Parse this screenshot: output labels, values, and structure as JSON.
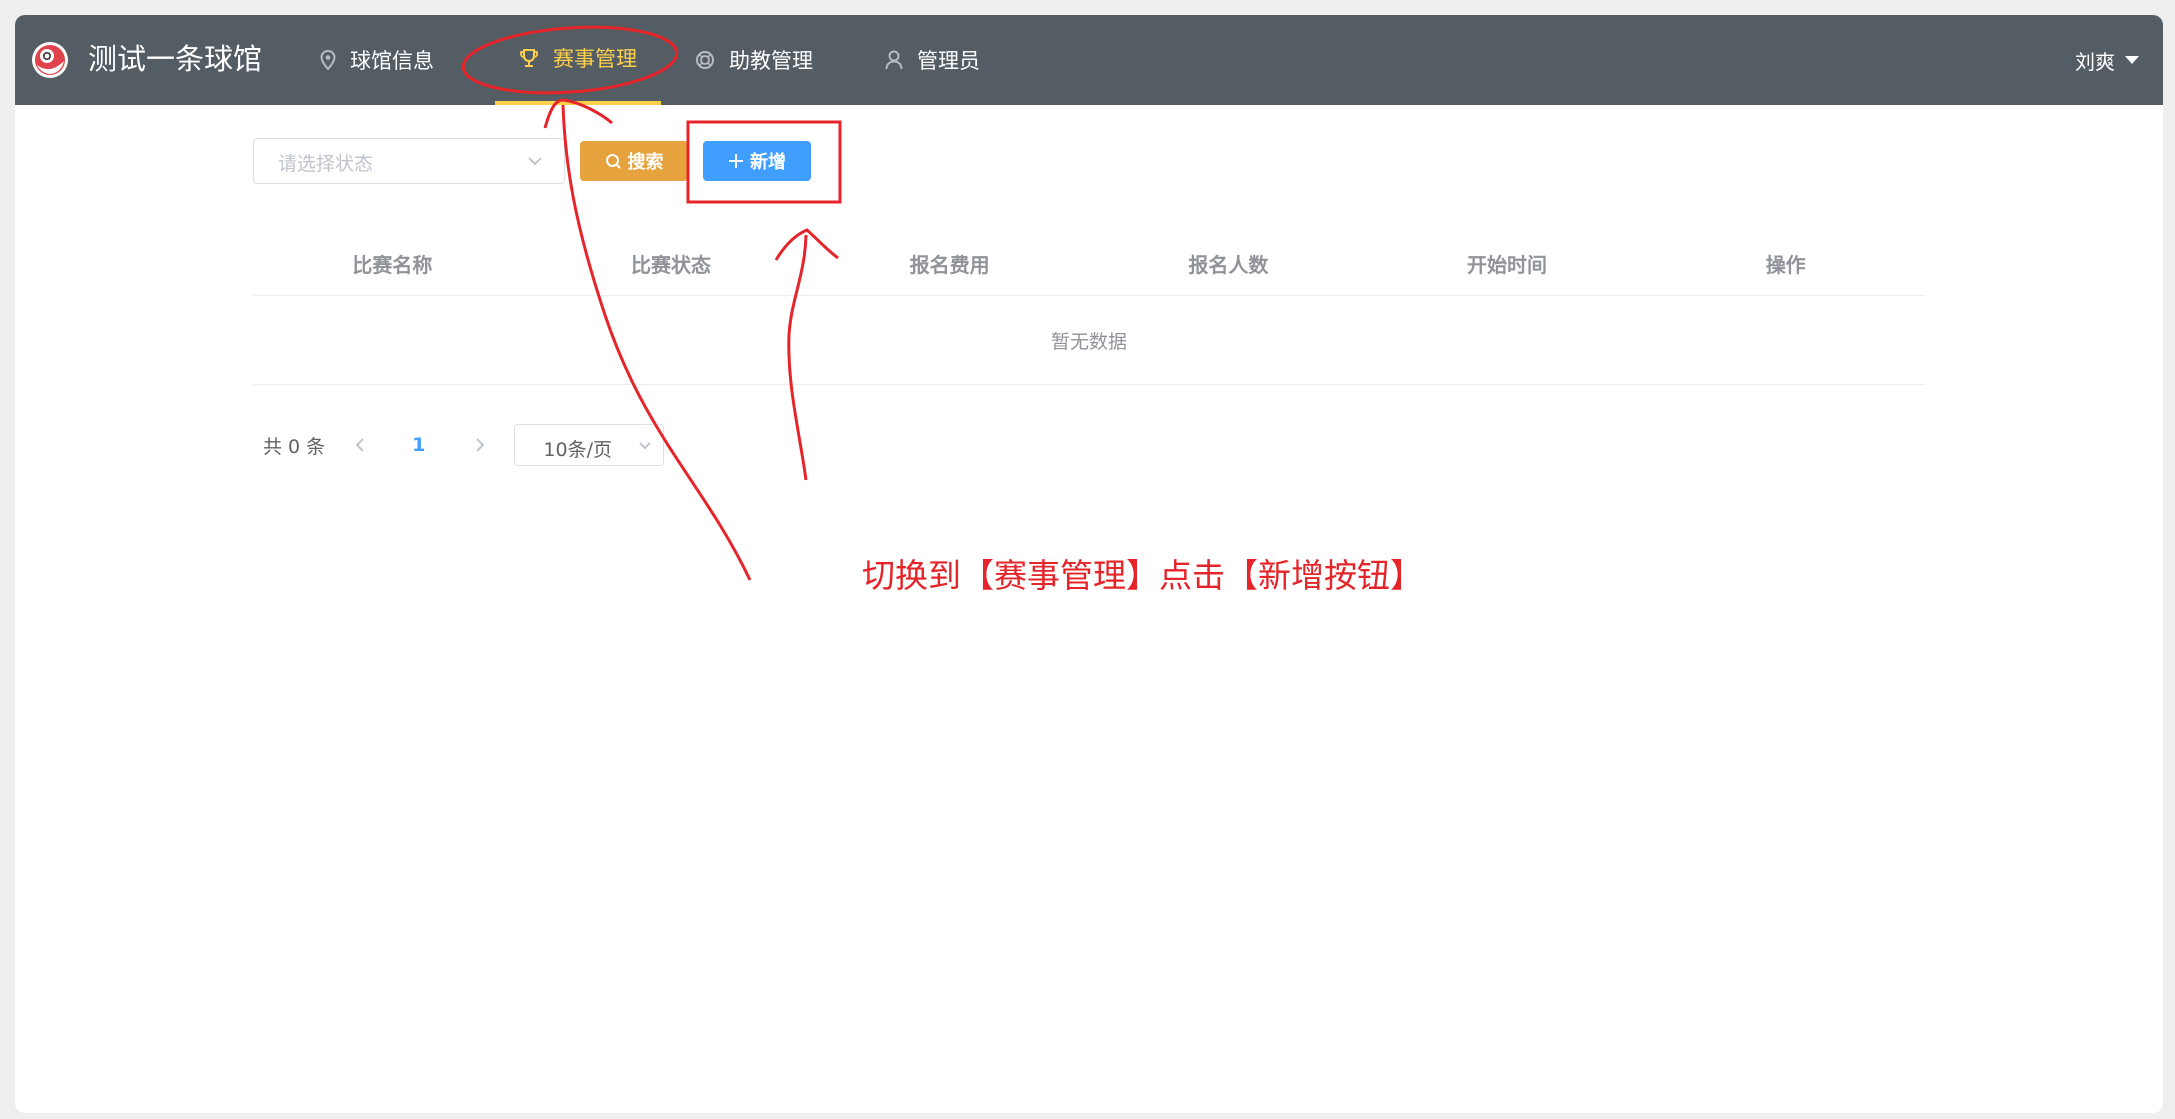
{
  "header": {
    "brand": "测试一条球馆",
    "nav": [
      {
        "label": "球馆信息",
        "icon": "location-icon"
      },
      {
        "label": "赛事管理",
        "icon": "trophy-icon",
        "active": true
      },
      {
        "label": "助教管理",
        "icon": "lifebuoy-icon"
      },
      {
        "label": "管理员",
        "icon": "user-icon"
      }
    ],
    "user": "刘爽"
  },
  "filter": {
    "status_placeholder": "请选择状态"
  },
  "toolbar": {
    "search_label": "搜索",
    "add_label": "新增"
  },
  "table": {
    "columns": [
      "比赛名称",
      "比赛状态",
      "报名费用",
      "报名人数",
      "开始时间",
      "操作"
    ],
    "empty_text": "暂无数据"
  },
  "pagination": {
    "total": "共 0 条",
    "current_page": "1",
    "page_size": "10条/页"
  },
  "annotation": {
    "text": "切换到【赛事管理】点击【新增按钮】",
    "color": "#e5252a"
  },
  "colors": {
    "navbar": "#545c64",
    "active": "#ffd04b",
    "warning": "#e6a23c",
    "primary": "#409eff"
  }
}
